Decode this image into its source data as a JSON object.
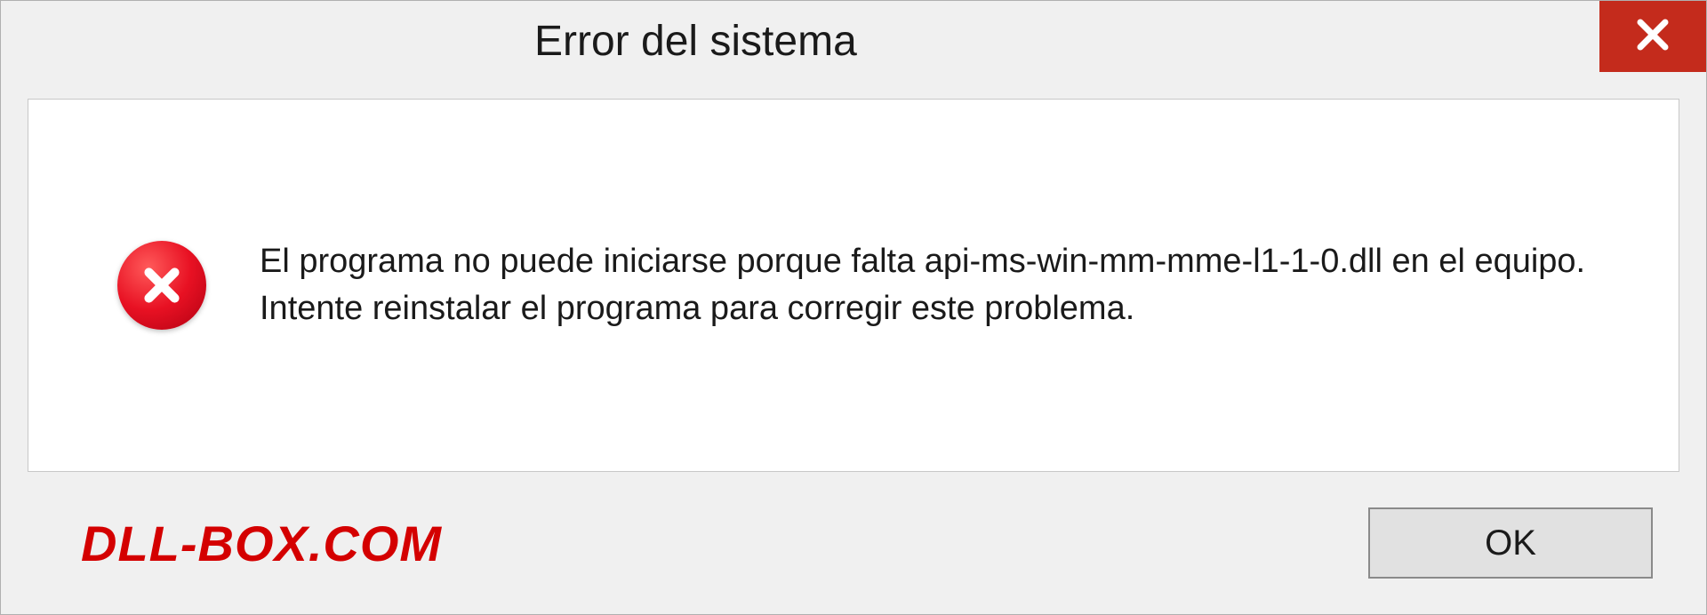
{
  "dialog": {
    "title": "Error del sistema",
    "message": "El programa no puede iniciarse porque falta api-ms-win-mm-mme-l1-1-0.dll en el equipo. Intente reinstalar el programa para corregir este problema.",
    "ok_label": "OK"
  },
  "watermark": "DLL-BOX.COM",
  "colors": {
    "close_bg": "#c42b1c",
    "error_red": "#e81123",
    "watermark_red": "#d40000"
  }
}
